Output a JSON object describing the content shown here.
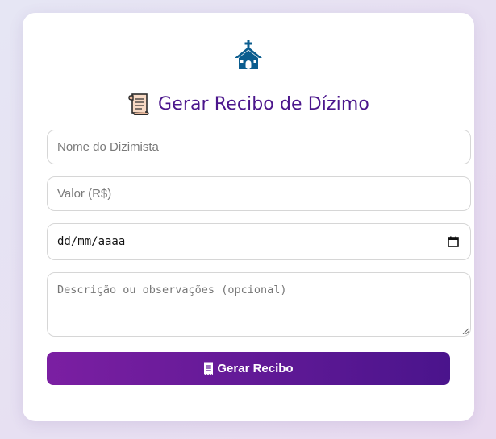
{
  "header": {
    "church_icon": "church-icon",
    "scroll_icon": "scroll-icon",
    "title": "Gerar Recibo de Dízimo"
  },
  "form": {
    "name_placeholder": "Nome do Dizimista",
    "value_placeholder": "Valor (R$)",
    "date_placeholder": "dd/mm/aaaa",
    "description_placeholder": "Descrição ou observações (opcional)",
    "submit_icon": "receipt-icon",
    "submit_label": "Gerar Recibo"
  },
  "colors": {
    "title": "#4b168c",
    "church": "#0b5d8f",
    "button_start": "#7b1fa2",
    "button_end": "#4a148c"
  }
}
